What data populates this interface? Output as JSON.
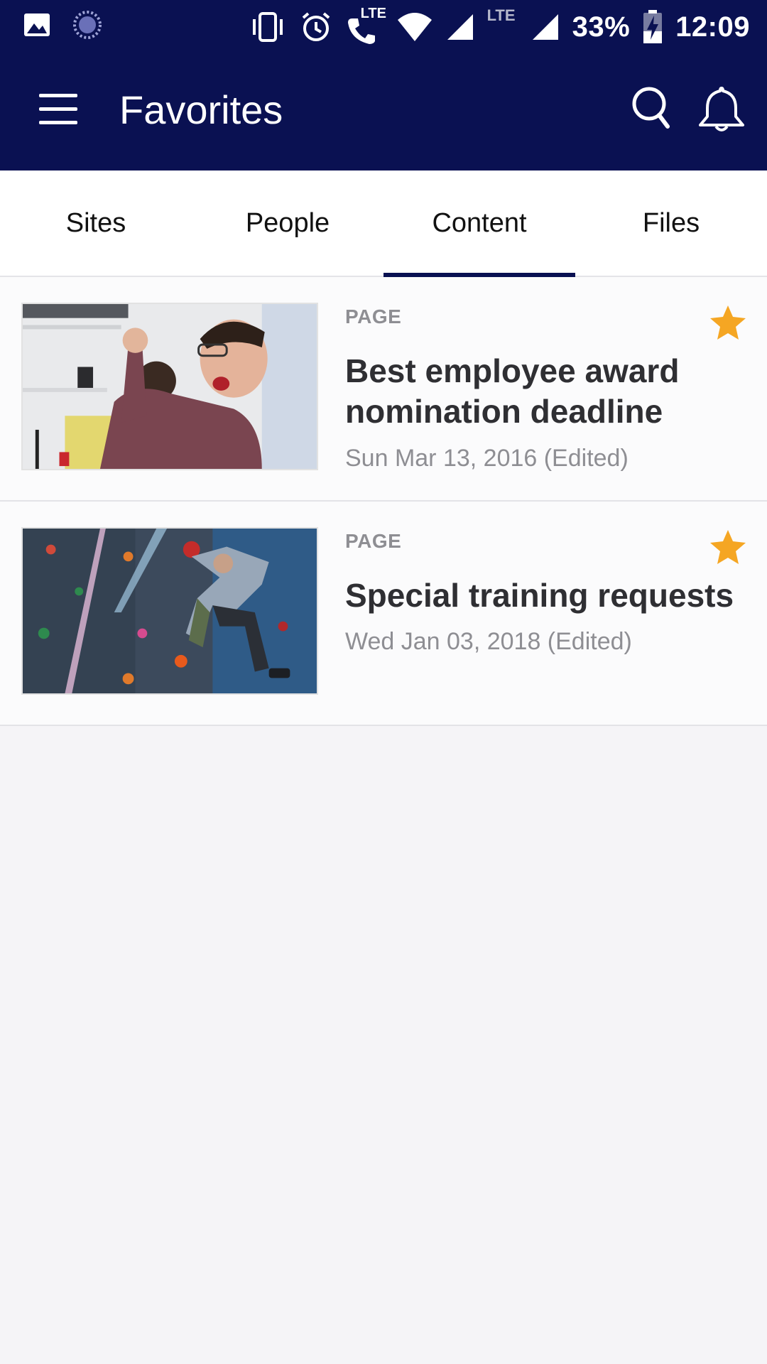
{
  "status_bar": {
    "lte_top": "LTE",
    "lte_signal": "LTE",
    "battery": "33%",
    "time": "12:09"
  },
  "app_bar": {
    "title": "Favorites"
  },
  "tabs": [
    {
      "label": "Sites",
      "active": false
    },
    {
      "label": "People",
      "active": false
    },
    {
      "label": "Content",
      "active": true
    },
    {
      "label": "Files",
      "active": false
    }
  ],
  "items": [
    {
      "type": "PAGE",
      "title": "Best employee award nomination deadline",
      "date": "Sun Mar 13, 2016 (Edited)",
      "thumbnail": "celebrating-man-photo",
      "favorited": true
    },
    {
      "type": "PAGE",
      "title": "Special training requests",
      "date": "Wed Jan 03, 2018 (Edited)",
      "thumbnail": "climbing-wall-photo",
      "favorited": true
    }
  ],
  "colors": {
    "primary": "#0a1152",
    "star": "#f5a623",
    "background": "#f5f4f7"
  }
}
